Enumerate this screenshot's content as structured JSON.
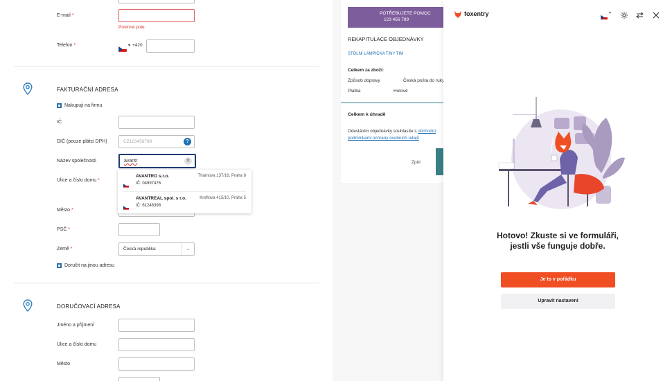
{
  "form": {
    "email_label": "E-mail",
    "required_mark": "*",
    "email_error": "Povinné pole",
    "phone_label": "Telefon",
    "phone_prefix": "+420",
    "billing_title": "FAKTURAČNÍ ADRESA",
    "buy_as_company": "Nakupuji na firmu",
    "ic_label": "IČ",
    "dic_label": "DIČ (pouze plátci DPH)",
    "dic_placeholder": "CZ123456789",
    "company_label": "Název společnosti",
    "company_value": "avantr",
    "street_label": "Ulice a číslo domu",
    "city_label": "Město",
    "zip_label": "PSČ",
    "country_label": "Země",
    "country_value": "Česká republika",
    "ship_elsewhere": "Doručit na jinou adresu",
    "delivery_title": "DORUČOVACÍ ADRESA",
    "name_label": "Jméno a příjmení",
    "street2_label": "Ulice a číslo domu",
    "city2_label": "Město"
  },
  "suggestions": [
    {
      "name": "AVANTRO s.r.o.",
      "ic": "IČ: 04997476",
      "address": "Thámova 137/16, Praha 8"
    },
    {
      "name": "AVANTREAL spol. s r.o.",
      "ic": "IČ: 61248398",
      "address": "Kroftova 415/10, Praha 5"
    }
  ],
  "summary": {
    "help_line1": "POTŘEBUJETE POMOC",
    "help_phone": "123 456 789",
    "title": "REKAPITULACE OBJEDNÁVKY",
    "product": "STOLNÍ LAMPIČKA TINY TIM",
    "goods_total": "Celkem za zboží:",
    "shipping_label": "Způsob dopravy",
    "shipping_value": "Česká pošta do ruky",
    "payment_label": "Platba",
    "payment_value": "Hotově",
    "total_label": "Celkem k úhradě",
    "terms_text": "Odesláním objednávky souhlasíte s",
    "terms_link1": "obchodní",
    "terms_link2": "podmínkami ochrany osobních údajů",
    "back": "Zpět"
  },
  "panel": {
    "brand": "foxentry",
    "heading_line1": "Hotovo! Zkuste si ve formuláři,",
    "heading_line2": "jestli vše funguje dobře.",
    "ok_button": "Je to v pořádku",
    "settings_button": "Upravit nastavení",
    "accent": "#f04e23"
  },
  "icons": [
    "flag-cz-icon",
    "chevron-down-icon",
    "sun-icon",
    "swap-icon",
    "close-icon",
    "location-pin-icon",
    "help-icon",
    "clear-icon"
  ]
}
